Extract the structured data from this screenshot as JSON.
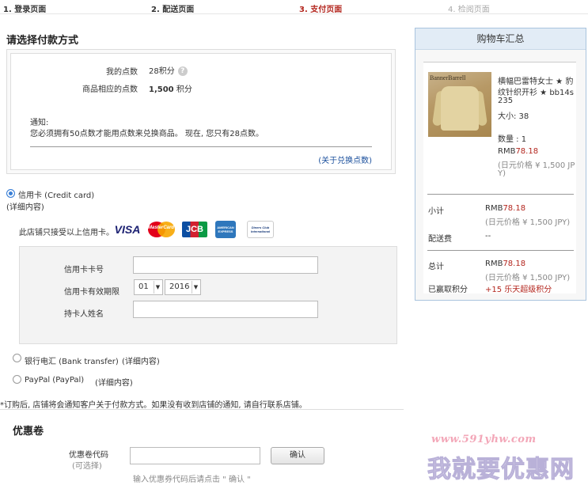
{
  "steps": [
    "1. 登录页面",
    "2. 配送页面",
    "3. 支付页面",
    "4. 检阅页面"
  ],
  "payment": {
    "title": "请选择付款方式",
    "points": {
      "my_points_label": "我的点数",
      "my_points_value": "28积分",
      "product_points_label": "商品相应的点数",
      "product_points_value": "1,500",
      "product_points_unit": "积分",
      "notice_title": "通知:",
      "notice_text": "您必须拥有50点数才能用点数来兑换商品。 现在, 您只有28点数。",
      "about_link": "(关于兑换点数)"
    },
    "credit_card": {
      "label": "信用卡 (Credit card)",
      "details_link": "(详细内容)",
      "accepted_text": "此店铺只接受以上信用卡。",
      "brands": [
        "VISA",
        "MasterCard",
        "JCB",
        "AMERICAN EXPRESS",
        "Diners Club International"
      ],
      "number_label": "信用卡卡号",
      "expiry_label": "信用卡有效期限",
      "expiry_month": "01",
      "expiry_year": "2016",
      "holder_label": "持卡人姓名"
    },
    "bank": {
      "label": "银行电汇 (Bank transfer)",
      "details_link": "(详细内容)"
    },
    "paypal": {
      "label": "PayPal (PayPal)",
      "details_link": "(详细内容)"
    },
    "footnote": "*订购后, 店铺将会通知客户关于付款方式。如果没有收到店铺的通知, 请自行联系店铺。"
  },
  "coupon": {
    "title": "优惠卷",
    "code_label": "优惠卷代码",
    "optional": "(可选择)",
    "confirm_button": "确认",
    "hint": "输入优惠券代码后请点击 \" 确认 \""
  },
  "cart": {
    "title": "购物车汇总",
    "image_logo": "BannerBarrell",
    "product_name_1": "横幅巴雷特女士 ★ 豹",
    "product_name_2": "纹针织开衫 ★ bb14s",
    "product_name_3": "235",
    "size": "大小: 38",
    "qty": "数量 : 1",
    "price_prefix": "RMB",
    "price": "78.18",
    "jpy_1": "(日元价格 ¥ 1,500 JP",
    "jpy_2": "Y)",
    "subtotal_label": "小计",
    "subtotal_prefix": "RMB",
    "subtotal": "78.18",
    "subtotal_jpy": "(日元价格 ¥ 1,500 JPY)",
    "shipping_label": "配送费",
    "shipping_value": "--",
    "total_label": "总计",
    "total_prefix": "RMB",
    "total": "78.18",
    "total_jpy": "(日元价格 ¥ 1,500 JPY)",
    "earned_label": "已赢取积分",
    "earned_value": "+15",
    "earned_unit": "乐天超级积分"
  },
  "watermark": {
    "url": "www.591yhw.com",
    "text": "我就要优惠网"
  },
  "colors": {
    "accent": "#b3261e",
    "link": "#1a4f9c",
    "radio": "#3a7fd6",
    "cart_border": "#a9c4de"
  }
}
